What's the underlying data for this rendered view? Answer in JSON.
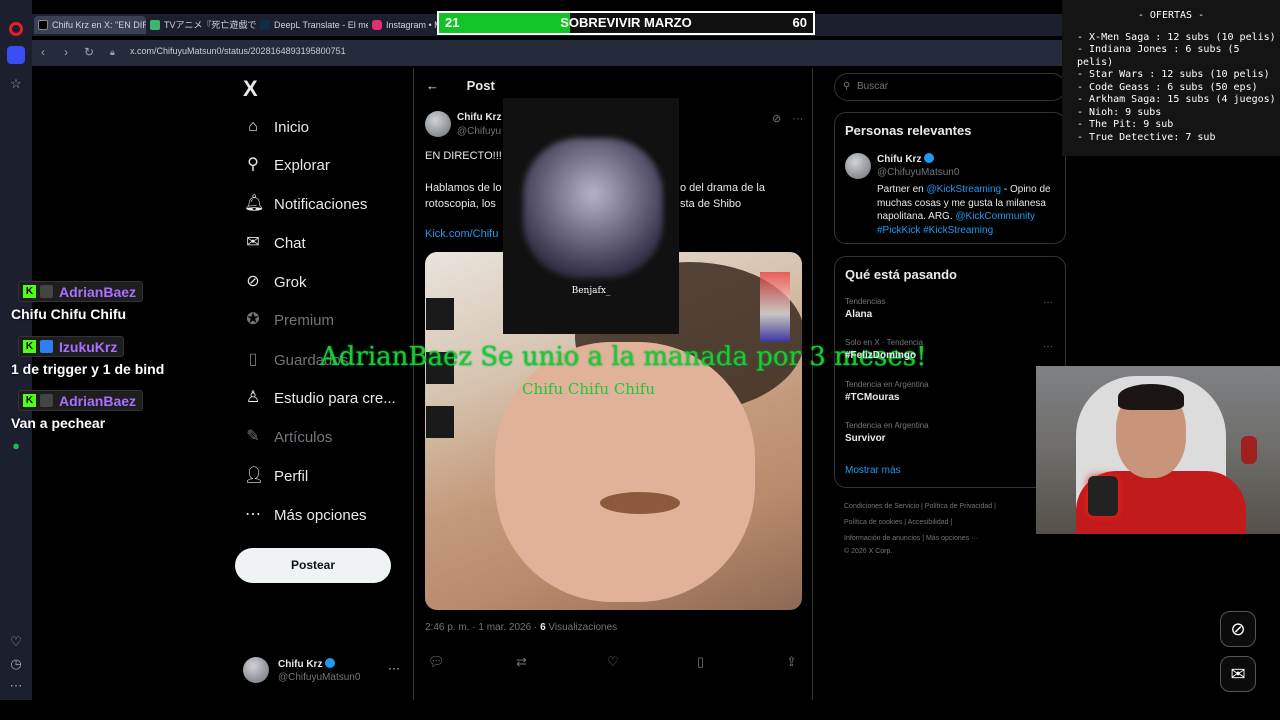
{
  "browser": {
    "tabs": [
      {
        "label": "Chifu Krz en X: \"EN DIREC",
        "fav_color": "#000000"
      },
      {
        "label": "TVアニメ『死亡遊戯で飯を食",
        "fav_color": "#3cb46e"
      },
      {
        "label": "DeepL Translate - El mejor",
        "fav_color": "#0f2b46"
      },
      {
        "label": "Instagram • M",
        "fav_color": "#e1306c"
      }
    ],
    "url": "x.com/ChifuyuMatsun0/status/2028164893195800751"
  },
  "goal": {
    "title": "SOBREVIVIR MARZO",
    "current": "21",
    "target": "60",
    "progress": 0.35
  },
  "offers": {
    "title": "- OFERTAS -",
    "items": [
      "- X-Men Saga : 12 subs (10 pelis)",
      "- Indiana Jones : 6 subs (5 pelis)",
      "- Star Wars : 12 subs (10 pelis)",
      "- Code Geass : 6 subs (50 eps)",
      "- Arkham Saga: 15 subs (4 juegos)",
      "- Nioh: 9 subs",
      "- The Pit: 9 sub",
      "- True Detective: 7 sub"
    ]
  },
  "nav": {
    "logo": "X",
    "items": [
      {
        "label": "Inicio",
        "icon": "home-icon",
        "glyph": "⌂"
      },
      {
        "label": "Explorar",
        "icon": "search-icon",
        "glyph": "⚲"
      },
      {
        "label": "Notificaciones",
        "icon": "bell-icon",
        "glyph": "🔔︎"
      },
      {
        "label": "Chat",
        "icon": "mail-icon",
        "glyph": "✉"
      },
      {
        "label": "Grok",
        "icon": "grok-icon",
        "glyph": "⊘"
      },
      {
        "label": "Premium",
        "icon": "premium-icon",
        "glyph": "✪"
      },
      {
        "label": "Guardados",
        "icon": "bookmark-icon",
        "glyph": "▯"
      },
      {
        "label": "Estudio para cre...",
        "icon": "studio-icon",
        "glyph": "♙"
      },
      {
        "label": "Artículos",
        "icon": "articles-icon",
        "glyph": "✎"
      },
      {
        "label": "Perfil",
        "icon": "profile-icon",
        "glyph": "👤︎"
      },
      {
        "label": "Más opciones",
        "icon": "more-icon",
        "glyph": "⋯"
      }
    ],
    "post_button": "Postear"
  },
  "account": {
    "name": "Chifu Krz",
    "handle": "@ChifuyuMatsun0"
  },
  "post": {
    "header": "Post",
    "author_name": "Chifu Krz",
    "author_handle": "@Chifuyu",
    "line1": "EN DIRECTO!!!",
    "line2": "Hablamos de lo",
    "line2b": "o del drama de la",
    "line3": "rotoscopia, los",
    "line3b": "sta de Shibo",
    "link": "Kick.com/Chifu",
    "time": "2:46 p. m. · 1 mar. 2026 · ",
    "views_count": "6",
    "views_label": " Visualizaciones"
  },
  "overlay": {
    "popup_label": "Benjafx_",
    "alert_main": "AdrianBaez Se unio a la manada por 3 meses!",
    "alert_sub": "Chifu Chifu Chifu"
  },
  "chat": [
    {
      "user": "AdrianBaez",
      "badge_color": "#444444",
      "message": "Chifu Chifu Chifu"
    },
    {
      "user": "IzukuKrz",
      "badge_color": "#2d7df5",
      "message": "1 de trigger y 1 de bind"
    },
    {
      "user": "AdrianBaez",
      "badge_color": "#444444",
      "message": "Van a pechear"
    }
  ],
  "right": {
    "search_placeholder": "Buscar",
    "relevant_title": "Personas relevantes",
    "rel_name": "Chifu Krz",
    "rel_handle": "@ChifuyuMatsun0",
    "bio_1": "Partner en ",
    "bio_link1": "@KickStreaming",
    "bio_2": " - Opino de",
    "bio_3": "muchas cosas y me gusta la milanesa",
    "bio_4": "napolitana. ARG. ",
    "bio_link2": "@KickCommunity",
    "bio_tags": "#PickKick #KickStreaming",
    "trending_title": "Qué está pasando",
    "trends": [
      {
        "cat": "Tendencias",
        "name": "Alana"
      },
      {
        "cat": "Solo en X · Tendencia",
        "name": "#FelizDomingo"
      },
      {
        "cat": "Tendencia en Argentina",
        "name": "#TCMouras"
      },
      {
        "cat": "Tendencia en Argentina",
        "name": "Survivor"
      }
    ],
    "show_more": "Mostrar más",
    "footer": [
      "Condiciones de Servicio  |  Política de Privacidad  |",
      "Política de cookies  |  Accesibilidad  |",
      "Información de anuncios  |  Más opciones ···",
      "© 2026 X Corp."
    ]
  }
}
